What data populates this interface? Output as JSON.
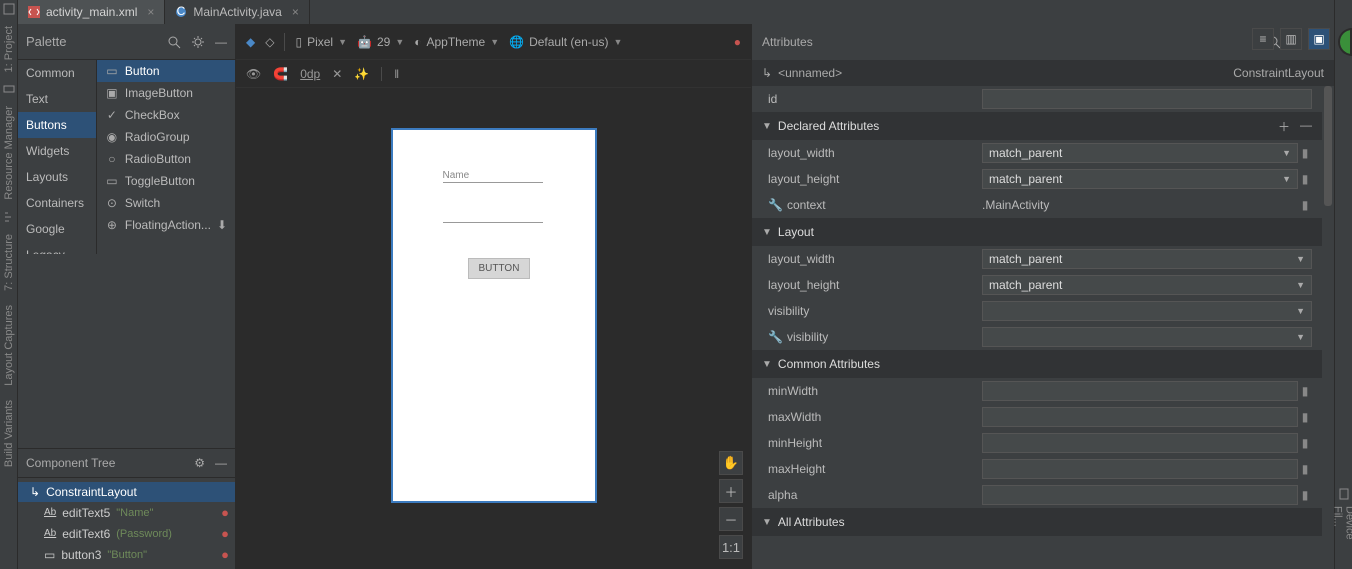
{
  "tabs": [
    {
      "label": "activity_main.xml",
      "icon": "xml-icon",
      "active": true
    },
    {
      "label": "MainActivity.java",
      "icon": "java-icon",
      "active": false
    }
  ],
  "left_rail": {
    "items": [
      "1: Project",
      "Resource Manager",
      "7: Structure",
      "Layout Captures",
      "Build Variants"
    ]
  },
  "right_rail": {
    "items": [
      "Device Fil..."
    ]
  },
  "palette": {
    "title": "Palette",
    "categories": [
      "Common",
      "Text",
      "Buttons",
      "Widgets",
      "Layouts",
      "Containers",
      "Google",
      "Legacy"
    ],
    "selected_category": "Buttons",
    "items": [
      {
        "label": "Button",
        "icon": "button-icon",
        "selected": true
      },
      {
        "label": "ImageButton",
        "icon": "image-icon"
      },
      {
        "label": "CheckBox",
        "icon": "check-icon"
      },
      {
        "label": "RadioGroup",
        "icon": "radiogroup-icon"
      },
      {
        "label": "RadioButton",
        "icon": "radio-icon"
      },
      {
        "label": "ToggleButton",
        "icon": "toggle-icon"
      },
      {
        "label": "Switch",
        "icon": "switch-icon"
      },
      {
        "label": "FloatingAction...",
        "icon": "fab-icon",
        "download": true
      }
    ]
  },
  "component_tree": {
    "title": "Component Tree",
    "rows": [
      {
        "indent": 0,
        "icon": "layout-icon",
        "label": "ConstraintLayout",
        "hint": "",
        "error": false,
        "selected": true
      },
      {
        "indent": 1,
        "icon": "text-icon",
        "label": "editText5",
        "hint": "\"Name\"",
        "error": true
      },
      {
        "indent": 1,
        "icon": "text-icon",
        "label": "editText6",
        "hint": "(Password)",
        "error": true
      },
      {
        "indent": 1,
        "icon": "button-sm-icon",
        "label": "button3",
        "hint": "\"Button\"",
        "error": true
      }
    ]
  },
  "design_toolbar": {
    "device": "Pixel",
    "api": "29",
    "theme": "AppTheme",
    "locale": "Default (en-us)",
    "default_margin": "0dp"
  },
  "device_preview": {
    "name_hint": "Name",
    "button_label": "BUTTON"
  },
  "float_buttons": [
    "✋",
    "＋",
    "－",
    "1:1"
  ],
  "view_modes": [
    "code",
    "split",
    "design"
  ],
  "attributes": {
    "title": "Attributes",
    "selection": {
      "name": "<unnamed>",
      "type": "ConstraintLayout"
    },
    "id_label": "id",
    "id_value": "",
    "sections": {
      "declared": {
        "title": "Declared Attributes",
        "rows": [
          {
            "key": "layout_width",
            "value": "match_parent",
            "combo": true,
            "flag": true
          },
          {
            "key": "layout_height",
            "value": "match_parent",
            "combo": true,
            "flag": true
          },
          {
            "key": "context",
            "value": ".MainActivity",
            "wrench": true,
            "flag": true
          }
        ]
      },
      "layout": {
        "title": "Layout",
        "rows": [
          {
            "key": "layout_width",
            "value": "match_parent",
            "combo": true
          },
          {
            "key": "layout_height",
            "value": "match_parent",
            "combo": true
          },
          {
            "key": "visibility",
            "value": "",
            "combo": true
          },
          {
            "key": "visibility",
            "value": "",
            "combo": true,
            "wrench": true
          }
        ]
      },
      "common": {
        "title": "Common Attributes",
        "rows": [
          {
            "key": "minWidth",
            "value": "",
            "flag": true
          },
          {
            "key": "maxWidth",
            "value": "",
            "flag": true
          },
          {
            "key": "minHeight",
            "value": "",
            "flag": true
          },
          {
            "key": "maxHeight",
            "value": "",
            "flag": true
          },
          {
            "key": "alpha",
            "value": "",
            "flag": true
          }
        ]
      },
      "all": {
        "title": "All Attributes"
      }
    }
  }
}
